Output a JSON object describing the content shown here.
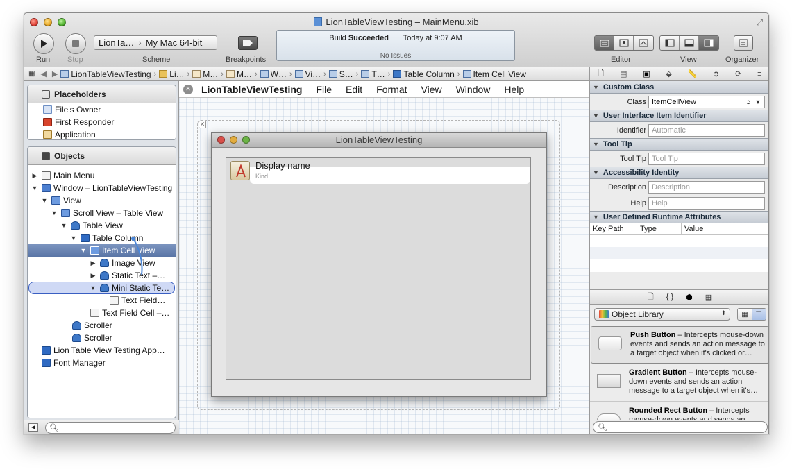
{
  "window": {
    "title": "LionTableViewTesting – MainMenu.xib"
  },
  "toolbar": {
    "run_label": "Run",
    "stop_label": "Stop",
    "scheme_target": "LionTa…",
    "scheme_destination": "My Mac 64-bit",
    "scheme_label": "Scheme",
    "breakpoints_label": "Breakpoints",
    "activity": {
      "status_prefix": "Build",
      "status_bold": "Succeeded",
      "time": "Today at 9:07 AM",
      "issues": "No Issues"
    },
    "editor_label": "Editor",
    "view_label": "View",
    "organizer_label": "Organizer"
  },
  "jumpbar": {
    "items": [
      "LionTableViewTesting",
      "Li…",
      "M…",
      "M…",
      "W…",
      "Vi…",
      "S…",
      "T…",
      "Table Column",
      "Item Cell View"
    ]
  },
  "placeholders": {
    "title": "Placeholders",
    "items": [
      "File's Owner",
      "First Responder",
      "Application"
    ]
  },
  "objects": {
    "title": "Objects",
    "items": [
      "Main Menu",
      "Window – LionTableViewTesting",
      "View",
      "Scroll View – Table View",
      "Table View",
      "Table Column",
      "Item Cell View",
      "Image View",
      "Static Text –…",
      "Mini Static Te…",
      "Text Field…",
      "Text Field Cell –…",
      "Scroller",
      "Scroller",
      "Lion Table View Testing App…",
      "Font Manager"
    ]
  },
  "app_menu": {
    "app_name": "LionTableViewTesting",
    "items": [
      "File",
      "Edit",
      "Format",
      "View",
      "Window",
      "Help"
    ]
  },
  "design_window": {
    "title": "LionTableViewTesting",
    "cell_name": "Display name",
    "cell_kind": "Kind"
  },
  "inspector": {
    "custom_class": {
      "title": "Custom Class",
      "class_label": "Class",
      "class_value": "ItemCellView"
    },
    "ui_identifier": {
      "title": "User Interface Item Identifier",
      "identifier_label": "Identifier",
      "identifier_placeholder": "Automatic"
    },
    "tooltip": {
      "title": "Tool Tip",
      "label": "Tool Tip",
      "placeholder": "Tool Tip"
    },
    "accessibility": {
      "title": "Accessibility Identity",
      "description_label": "Description",
      "description_placeholder": "Description",
      "help_label": "Help",
      "help_placeholder": "Help"
    },
    "runtime_attributes": {
      "title": "User Defined Runtime Attributes",
      "columns": [
        "Key Path",
        "Type",
        "Value"
      ]
    }
  },
  "library": {
    "selected": "Object Library",
    "items": [
      {
        "name": "Push Button",
        "description": " – Intercepts mouse-down events and sends an action message to a target object when it's clicked or…"
      },
      {
        "name": "Gradient Button",
        "description": " – Intercepts mouse-down events and sends an action message to a target object when it's…"
      },
      {
        "name": "Rounded Rect Button",
        "description": " – Intercepts mouse-down events and sends an…"
      }
    ]
  }
}
